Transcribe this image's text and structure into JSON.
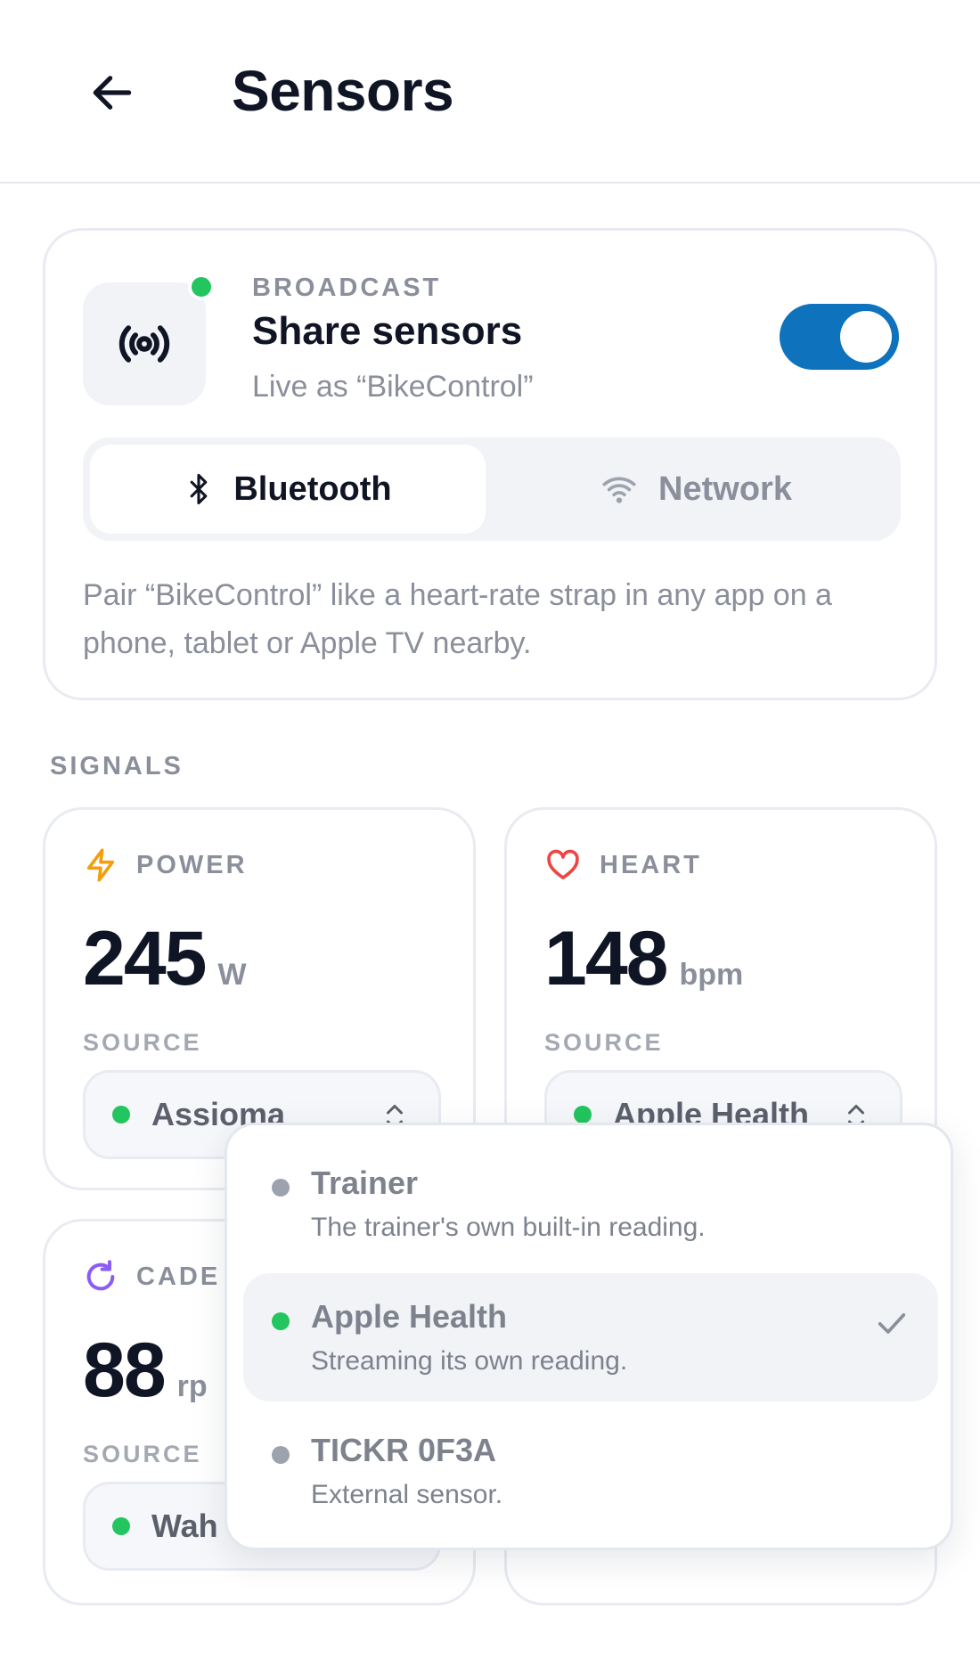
{
  "header": {
    "title": "Sensors"
  },
  "broadcast": {
    "eyebrow": "BROADCAST",
    "title": "Share sensors",
    "subtitle": "Live as “BikeControl”",
    "enabled": true,
    "modes": [
      {
        "label": "Bluetooth",
        "icon": "bluetooth-icon",
        "active": true
      },
      {
        "label": "Network",
        "icon": "wifi-icon",
        "active": false
      }
    ],
    "note": "Pair “BikeControl” like a heart-rate strap in any app on a phone, tablet or Apple TV nearby."
  },
  "signals": {
    "section_label": "SIGNALS",
    "source_label": "SOURCE",
    "power": {
      "label": "POWER",
      "value": "245",
      "unit": "W",
      "source": "Assioma",
      "icon": "lightning-icon",
      "accent": "#f59e0b"
    },
    "heart": {
      "label": "HEART",
      "value": "148",
      "unit": "bpm",
      "source": "Apple Health",
      "icon": "heart-icon",
      "accent": "#ef4444"
    },
    "cadence": {
      "label": "CADE",
      "value": "88",
      "unit": "rp",
      "source": "Wah",
      "icon": "refresh-icon",
      "accent": "#8b5cf6"
    }
  },
  "dropdown": {
    "options": [
      {
        "title": "Trainer",
        "desc": "The trainer's own built-in reading.",
        "status": "#9ca3af",
        "selected": false
      },
      {
        "title": "Apple Health",
        "desc": "Streaming its own reading.",
        "status": "#22c55e",
        "selected": true
      },
      {
        "title": "TICKR 0F3A",
        "desc": "External sensor.",
        "status": "#9ca3af",
        "selected": false
      }
    ]
  },
  "colors": {
    "accent": "#0e72bd",
    "live": "#22c55e"
  }
}
